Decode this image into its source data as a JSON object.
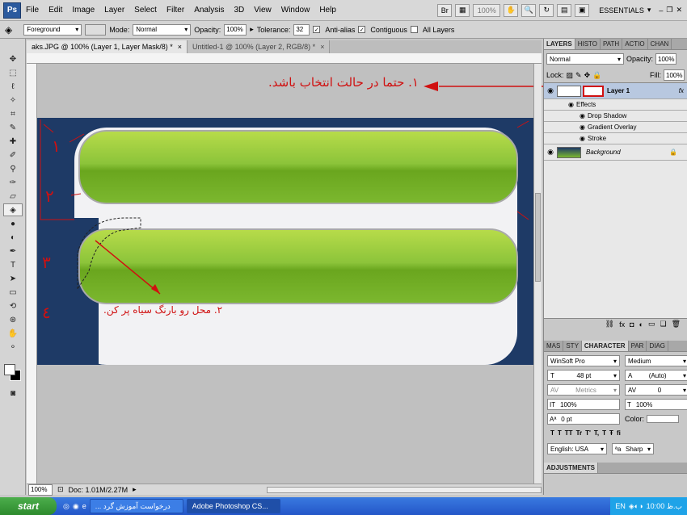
{
  "app": {
    "logo": "Ps"
  },
  "menu": [
    "File",
    "Edit",
    "Image",
    "Layer",
    "Select",
    "Filter",
    "Analysis",
    "3D",
    "View",
    "Window",
    "Help"
  ],
  "menu_right": {
    "zoom": "100%",
    "workspace": "ESSENTIALS"
  },
  "options": {
    "fill_source": "Foreground",
    "mode_label": "Mode:",
    "mode_value": "Normal",
    "opacity_label": "Opacity:",
    "opacity_value": "100%",
    "tolerance_label": "Tolerance:",
    "tolerance_value": "32",
    "anti_alias": "Anti-alias",
    "contiguous": "Contiguous",
    "all_layers": "All Layers"
  },
  "doc_tabs": [
    {
      "label": "aks.JPG @ 100% (Layer 1, Layer Mask/8) *"
    },
    {
      "label": "Untitled-1 @ 100% (Layer 2, RGB/8) *"
    }
  ],
  "canvas": {
    "annotation_1": "۱. حتما در حالت انتخاب باشد.",
    "annotation_2": "۲. محل رو بارنگ سیاه پر کن."
  },
  "status": {
    "zoom": "100%",
    "doc": "Doc: 1.01M/2.27M"
  },
  "layers_panel": {
    "tabs": [
      "LAYERS",
      "HISTO",
      "PATH",
      "ACTIO",
      "CHAN"
    ],
    "blend": "Normal",
    "opacity_label": "Opacity:",
    "opacity": "100%",
    "lock_label": "Lock:",
    "fill_label": "Fill:",
    "fill": "100%",
    "layers": [
      {
        "name": "Layer 1"
      },
      {
        "name": "Effects"
      },
      {
        "name": "Drop Shadow"
      },
      {
        "name": "Gradient Overlay"
      },
      {
        "name": "Stroke"
      },
      {
        "name": "Background"
      }
    ]
  },
  "char_panel": {
    "tabs": [
      "MAS",
      "STY",
      "CHARACTER",
      "PAR",
      "DIAG"
    ],
    "font": "WinSoft Pro",
    "style": "Medium",
    "size": "48 pt",
    "leading": "(Auto)",
    "kerning": "Metrics",
    "tracking": "0",
    "vscale": "100%",
    "hscale": "100%",
    "baseline": "0 pt",
    "color_label": "Color:",
    "language": "English: USA",
    "aa": "Sharp",
    "styles": [
      "T",
      "T",
      "TT",
      "Tr",
      "T'",
      "T,",
      "T",
      "Ŧ",
      "fi"
    ]
  },
  "adjustments": {
    "label": "ADJUSTMENTS"
  },
  "taskbar": {
    "start": "start",
    "tasks": [
      "... درخواست آموزش گرد",
      "Adobe Photoshop CS..."
    ],
    "lang": "EN",
    "clock": "10:00 ب.ظ"
  },
  "colors": {
    "accent": "#2b5a9e",
    "green": "#7cb82f",
    "red": "#d01010",
    "navy": "#1e3a66"
  }
}
